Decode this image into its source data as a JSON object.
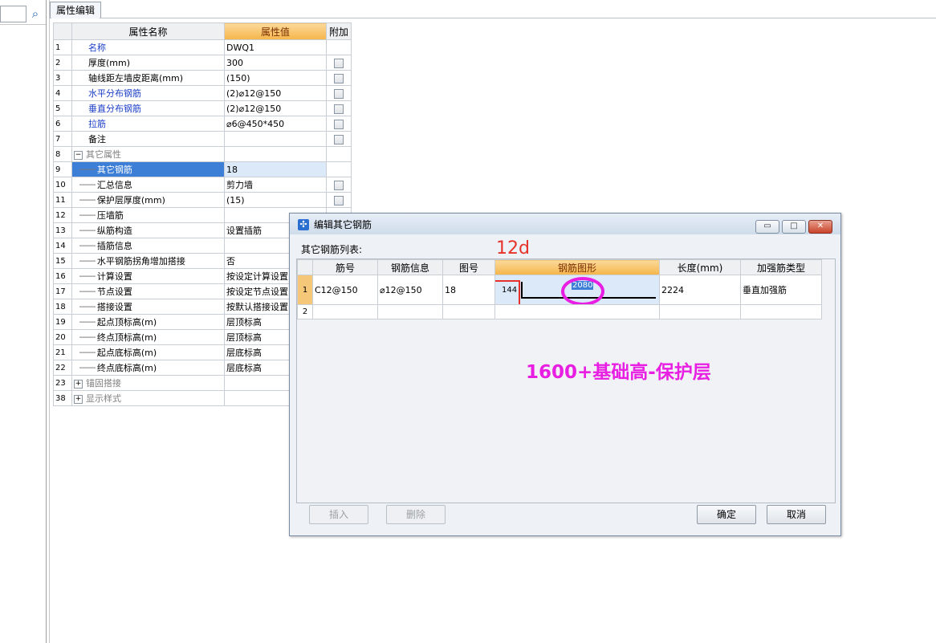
{
  "panel_tab": "属性编辑",
  "grid": {
    "headers": {
      "name": "属性名称",
      "value": "属性值",
      "extra": "附加"
    },
    "rows": [
      {
        "n": "1",
        "name": "名称",
        "value": "DWQ1",
        "blue": true,
        "chk": false
      },
      {
        "n": "2",
        "name": "厚度(mm)",
        "value": "300",
        "chk": true
      },
      {
        "n": "3",
        "name": "轴线距左墙皮距离(mm)",
        "value": "(150)",
        "chk": true
      },
      {
        "n": "4",
        "name": "水平分布钢筋",
        "value": "(2)⌀12@150",
        "blue": true,
        "chk": true
      },
      {
        "n": "5",
        "name": "垂直分布钢筋",
        "value": "(2)⌀12@150",
        "blue": true,
        "chk": true
      },
      {
        "n": "6",
        "name": "拉筋",
        "value": "⌀6@450*450",
        "blue": true,
        "chk": true
      },
      {
        "n": "7",
        "name": "备注",
        "value": "",
        "chk": true
      },
      {
        "n": "8",
        "name": "其它属性",
        "value": "",
        "group": "minus"
      },
      {
        "n": "9",
        "name": "其它钢筋",
        "value": "18",
        "child": true,
        "selected": true
      },
      {
        "n": "10",
        "name": "汇总信息",
        "value": "剪力墙",
        "child": true,
        "chk": true
      },
      {
        "n": "11",
        "name": "保护层厚度(mm)",
        "value": "(15)",
        "child": true,
        "chk": true
      },
      {
        "n": "12",
        "name": "压墙筋",
        "value": "",
        "child": true
      },
      {
        "n": "13",
        "name": "纵筋构造",
        "value": "设置插筋",
        "child": true
      },
      {
        "n": "14",
        "name": "插筋信息",
        "value": "",
        "child": true
      },
      {
        "n": "15",
        "name": "水平钢筋拐角增加搭接",
        "value": "否",
        "child": true
      },
      {
        "n": "16",
        "name": "计算设置",
        "value": "按设定计算设置",
        "child": true
      },
      {
        "n": "17",
        "name": "节点设置",
        "value": "按设定节点设置",
        "child": true
      },
      {
        "n": "18",
        "name": "搭接设置",
        "value": "按默认搭接设置",
        "child": true
      },
      {
        "n": "19",
        "name": "起点顶标高(m)",
        "value": "层顶标高",
        "child": true
      },
      {
        "n": "20",
        "name": "终点顶标高(m)",
        "value": "层顶标高",
        "child": true
      },
      {
        "n": "21",
        "name": "起点底标高(m)",
        "value": "层底标高",
        "child": true
      },
      {
        "n": "22",
        "name": "终点底标高(m)",
        "value": "层底标高",
        "child": true
      },
      {
        "n": "23",
        "name": "锚固搭接",
        "value": "",
        "group": "plus"
      },
      {
        "n": "38",
        "name": "显示样式",
        "value": "",
        "group": "plus"
      }
    ]
  },
  "dialog": {
    "title": "编辑其它钢筋",
    "list_label": "其它钢筋列表:",
    "win_minimize": "▭",
    "win_maximize": "□",
    "win_close": "✕",
    "columns": [
      "筋号",
      "钢筋信息",
      "图号",
      "钢筋图形",
      "长度(mm)",
      "加强筋类型"
    ],
    "rows": [
      {
        "n": "1",
        "code": "C12@150",
        "info": "⌀12@150",
        "fig": "18",
        "shape_left": "144",
        "shape_mid": "2080",
        "length": "2224",
        "type": "垂直加强筋"
      },
      {
        "n": "2",
        "code": "",
        "info": "",
        "fig": "",
        "length": "",
        "type": ""
      }
    ],
    "buttons": {
      "insert": "插入",
      "delete": "删除",
      "ok": "确定",
      "cancel": "取消"
    },
    "annotations": {
      "label_12d": "12d",
      "formula": "1600+基础高-保护层"
    }
  },
  "colors": {
    "annot_red": "#e6322b",
    "annot_magenta": "#e81fe3",
    "selection_blue": "#3d7fd6",
    "header_orange": "#f5b54a"
  }
}
